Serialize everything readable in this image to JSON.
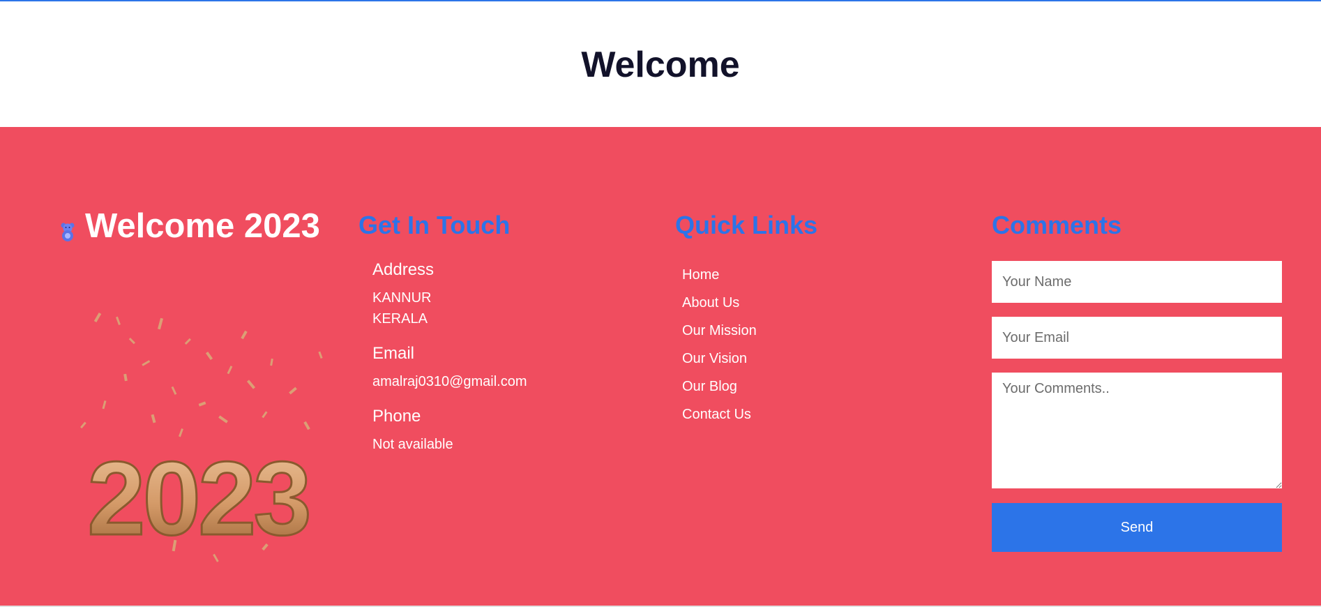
{
  "header": {
    "title": "Welcome"
  },
  "brand": {
    "icon": "teddy-bear-icon",
    "title": "Welcome 2023",
    "art_text": "2023"
  },
  "get_in_touch": {
    "heading": "Get In Touch",
    "address_label": "Address",
    "address_lines": [
      "KANNUR",
      "KERALA"
    ],
    "email_label": "Email",
    "email_value": "amalraj0310@gmail.com",
    "phone_label": "Phone",
    "phone_value": "Not available"
  },
  "quick_links": {
    "heading": "Quick Links",
    "items": [
      "Home",
      "About Us",
      "Our Mission",
      "Our Vision",
      "Our Blog",
      "Contact Us"
    ]
  },
  "comments": {
    "heading": "Comments",
    "name_placeholder": "Your Name",
    "email_placeholder": "Your Email",
    "comments_placeholder": "Your Comments..",
    "send_label": "Send"
  },
  "colors": {
    "accent": "#2c74e8",
    "footer_background": "#f04d5f",
    "title_text": "#12122a"
  }
}
